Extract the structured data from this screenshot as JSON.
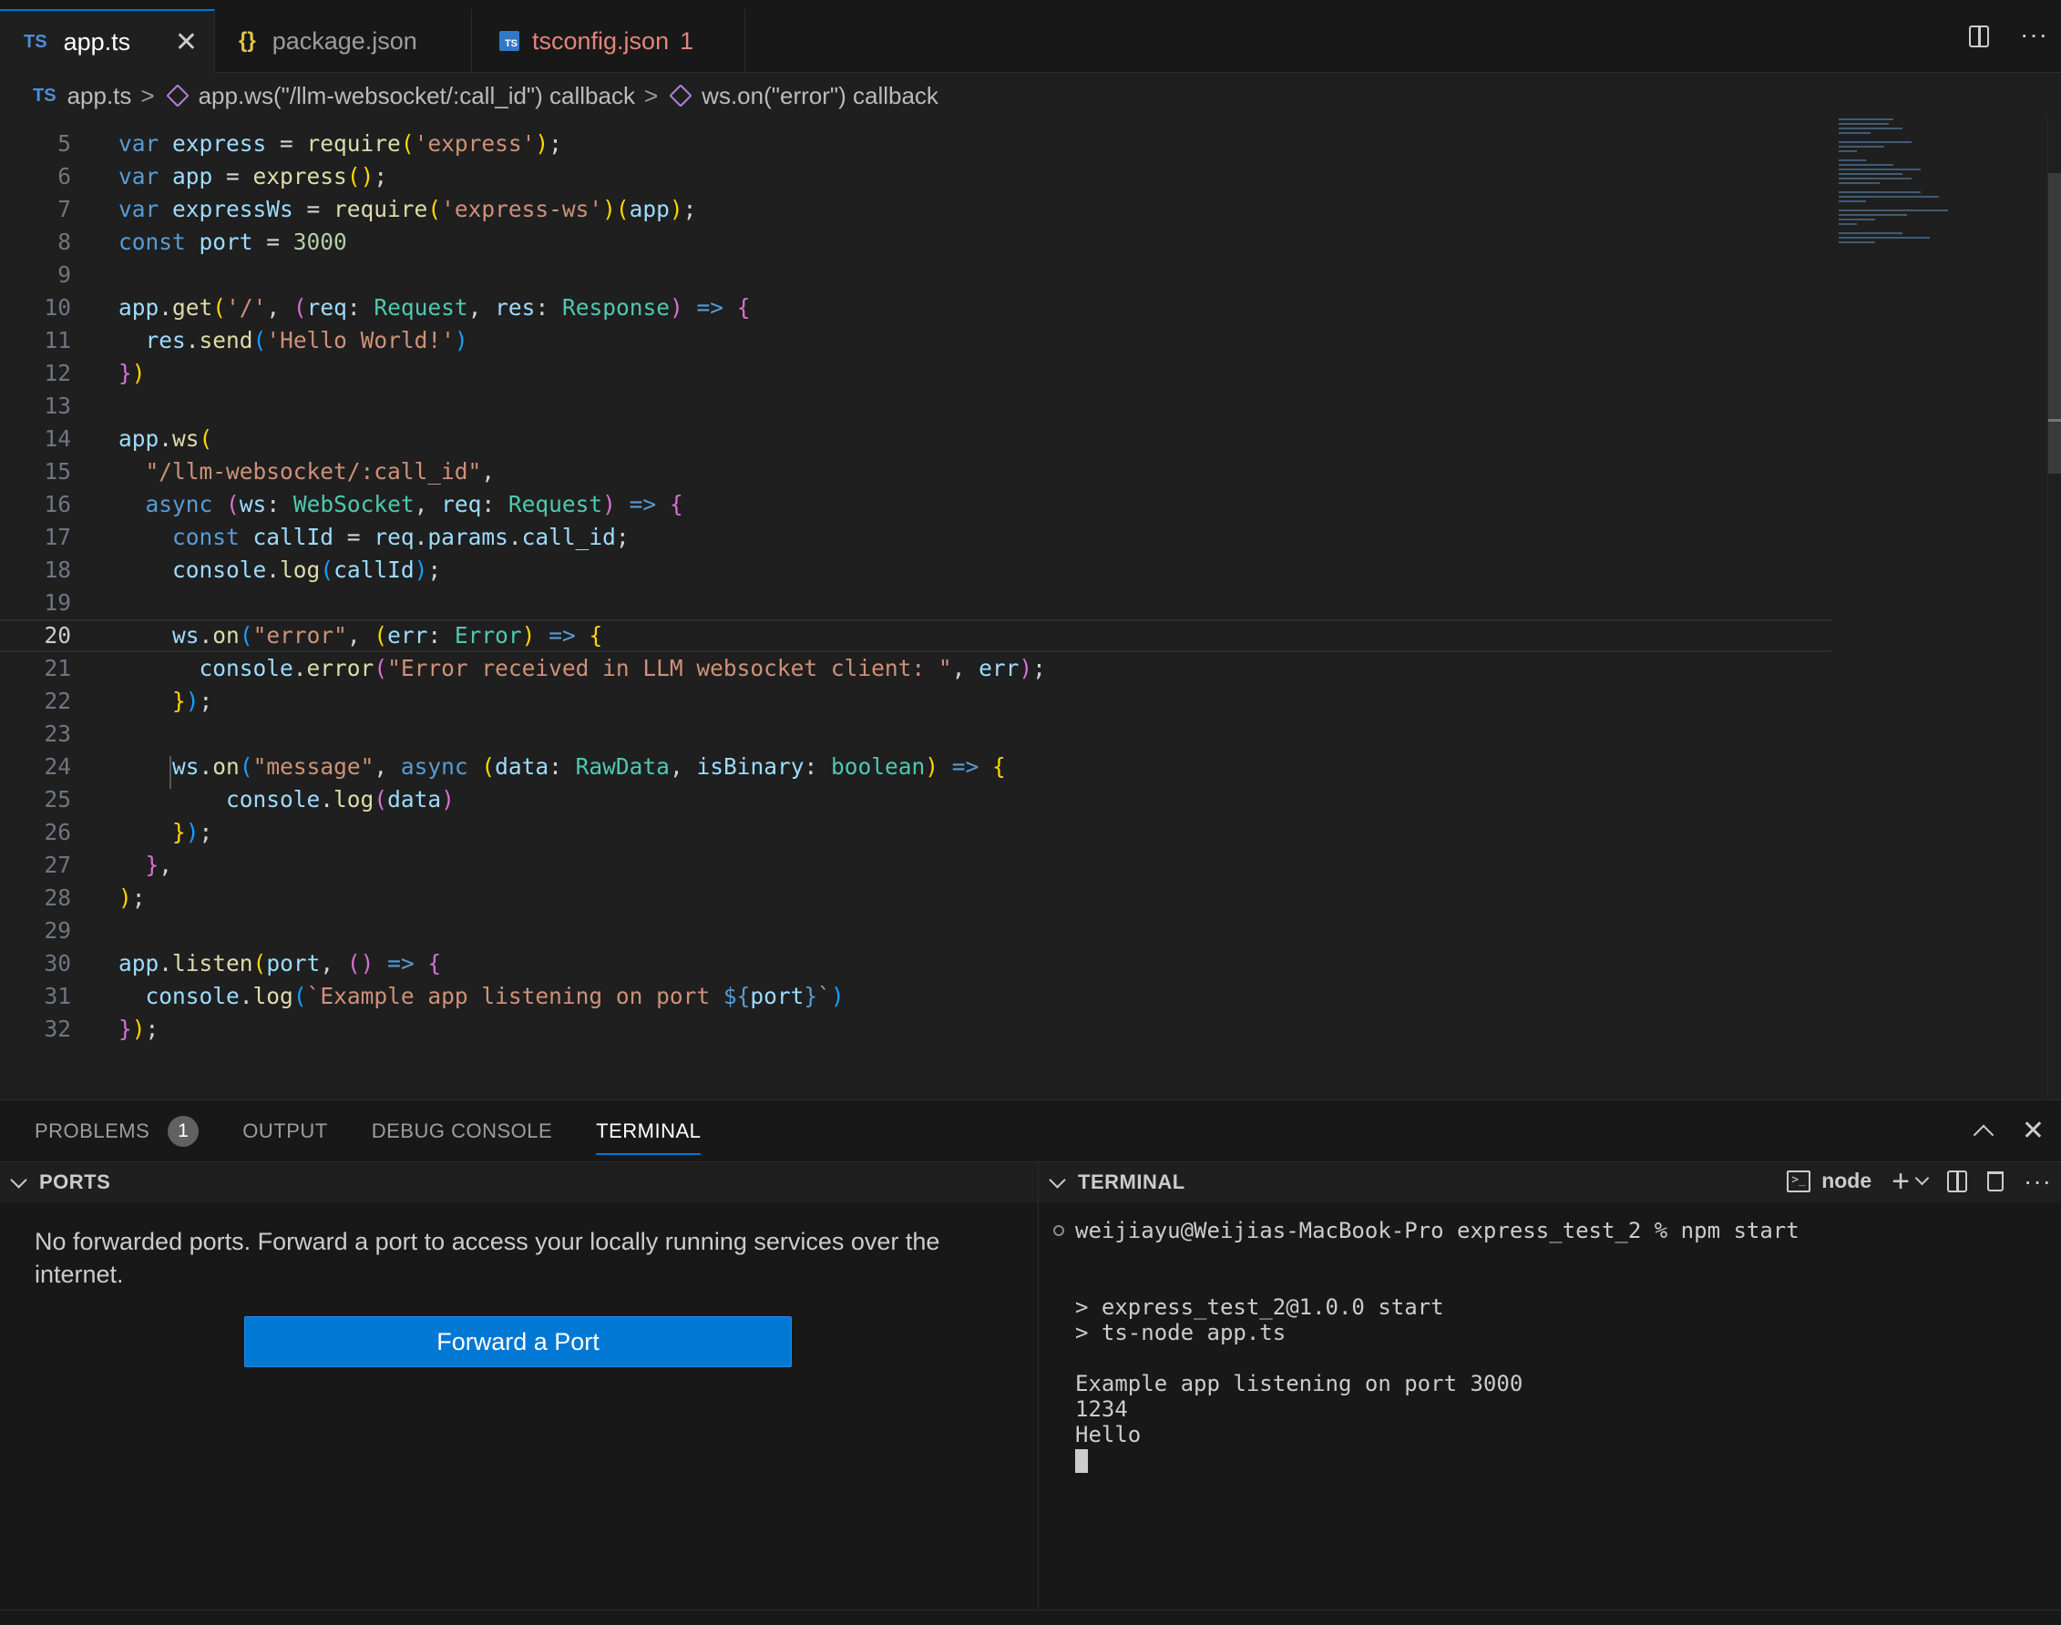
{
  "tabs": [
    {
      "icon": "TS",
      "label": "app.ts",
      "close": "✕"
    },
    {
      "icon": "{}",
      "label": "package.json"
    },
    {
      "icon": "TS",
      "label": "tsconfig.json",
      "problems": "1"
    }
  ],
  "breadcrumbs": {
    "file_icon": "TS",
    "file": "app.ts",
    "separator": ">",
    "symbol1": "app.ws(\"/llm-websocket/:call_id\") callback",
    "symbol2": "ws.on(\"error\") callback"
  },
  "editor": {
    "current_line": 20,
    "lines": [
      {
        "n": 5,
        "tokens": [
          [
            "kw",
            "var "
          ],
          [
            "var",
            "express"
          ],
          [
            "pl",
            " = "
          ],
          [
            "fn",
            "require"
          ],
          [
            "b1",
            "("
          ],
          [
            "str",
            "'express'"
          ],
          [
            "b1",
            ")"
          ],
          [
            "pl",
            ";"
          ]
        ]
      },
      {
        "n": 6,
        "tokens": [
          [
            "kw",
            "var "
          ],
          [
            "var",
            "app"
          ],
          [
            "pl",
            " = "
          ],
          [
            "fn",
            "express"
          ],
          [
            "b1",
            "()"
          ],
          [
            "pl",
            ";"
          ]
        ]
      },
      {
        "n": 7,
        "tokens": [
          [
            "kw",
            "var "
          ],
          [
            "var",
            "expressWs"
          ],
          [
            "pl",
            " = "
          ],
          [
            "fn",
            "require"
          ],
          [
            "b1",
            "("
          ],
          [
            "str",
            "'express-ws'"
          ],
          [
            "b1",
            ")("
          ],
          [
            "var",
            "app"
          ],
          [
            "b1",
            ")"
          ],
          [
            "pl",
            ";"
          ]
        ]
      },
      {
        "n": 8,
        "tokens": [
          [
            "kw",
            "const "
          ],
          [
            "var",
            "port"
          ],
          [
            "pl",
            " = "
          ],
          [
            "num",
            "3000"
          ]
        ]
      },
      {
        "n": 9,
        "tokens": []
      },
      {
        "n": 10,
        "tokens": [
          [
            "var",
            "app"
          ],
          [
            "pl",
            "."
          ],
          [
            "fn",
            "get"
          ],
          [
            "b1",
            "("
          ],
          [
            "str",
            "'/'"
          ],
          [
            "pl",
            ", "
          ],
          [
            "b2",
            "("
          ],
          [
            "var",
            "req"
          ],
          [
            "pl",
            ": "
          ],
          [
            "type",
            "Request"
          ],
          [
            "pl",
            ", "
          ],
          [
            "var",
            "res"
          ],
          [
            "pl",
            ": "
          ],
          [
            "type",
            "Response"
          ],
          [
            "b2",
            ")"
          ],
          [
            "kw",
            " => "
          ],
          [
            "b2",
            "{"
          ]
        ]
      },
      {
        "n": 11,
        "tokens": [
          [
            "pl",
            "  "
          ],
          [
            "var",
            "res"
          ],
          [
            "pl",
            "."
          ],
          [
            "fn",
            "send"
          ],
          [
            "b3",
            "("
          ],
          [
            "str",
            "'Hello World!'"
          ],
          [
            "b3",
            ")"
          ]
        ]
      },
      {
        "n": 12,
        "tokens": [
          [
            "b2",
            "}"
          ],
          [
            "b1",
            ")"
          ]
        ]
      },
      {
        "n": 13,
        "tokens": []
      },
      {
        "n": 14,
        "tokens": [
          [
            "var",
            "app"
          ],
          [
            "pl",
            "."
          ],
          [
            "fn",
            "ws"
          ],
          [
            "b1",
            "("
          ]
        ]
      },
      {
        "n": 15,
        "tokens": [
          [
            "pl",
            "  "
          ],
          [
            "str",
            "\"/llm-websocket/:call_id\""
          ],
          [
            "pl",
            ","
          ]
        ]
      },
      {
        "n": 16,
        "tokens": [
          [
            "pl",
            "  "
          ],
          [
            "kw",
            "async "
          ],
          [
            "b2",
            "("
          ],
          [
            "var",
            "ws"
          ],
          [
            "pl",
            ": "
          ],
          [
            "type",
            "WebSocket"
          ],
          [
            "pl",
            ", "
          ],
          [
            "var",
            "req"
          ],
          [
            "pl",
            ": "
          ],
          [
            "type",
            "Request"
          ],
          [
            "b2",
            ")"
          ],
          [
            "kw",
            " => "
          ],
          [
            "b2",
            "{"
          ]
        ]
      },
      {
        "n": 17,
        "tokens": [
          [
            "pl",
            "    "
          ],
          [
            "kw",
            "const "
          ],
          [
            "var",
            "callId"
          ],
          [
            "pl",
            " = "
          ],
          [
            "var",
            "req"
          ],
          [
            "pl",
            "."
          ],
          [
            "var",
            "params"
          ],
          [
            "pl",
            "."
          ],
          [
            "var",
            "call_id"
          ],
          [
            "pl",
            ";"
          ]
        ]
      },
      {
        "n": 18,
        "tokens": [
          [
            "pl",
            "    "
          ],
          [
            "var",
            "console"
          ],
          [
            "pl",
            "."
          ],
          [
            "fn",
            "log"
          ],
          [
            "b3",
            "("
          ],
          [
            "var",
            "callId"
          ],
          [
            "b3",
            ")"
          ],
          [
            "pl",
            ";"
          ]
        ]
      },
      {
        "n": 19,
        "tokens": []
      },
      {
        "n": 20,
        "tokens": [
          [
            "pl",
            "    "
          ],
          [
            "var",
            "ws"
          ],
          [
            "pl",
            "."
          ],
          [
            "fn",
            "on"
          ],
          [
            "b3",
            "("
          ],
          [
            "str",
            "\"error\""
          ],
          [
            "pl",
            ", "
          ],
          [
            "b1",
            "("
          ],
          [
            "var",
            "err"
          ],
          [
            "pl",
            ": "
          ],
          [
            "type",
            "Error"
          ],
          [
            "b1",
            ")"
          ],
          [
            "kw",
            " => "
          ],
          [
            "b1",
            "{"
          ]
        ]
      },
      {
        "n": 21,
        "tokens": [
          [
            "pl",
            "      "
          ],
          [
            "var",
            "console"
          ],
          [
            "pl",
            "."
          ],
          [
            "fn",
            "error"
          ],
          [
            "b2",
            "("
          ],
          [
            "str",
            "\"Error received in LLM websocket client: \""
          ],
          [
            "pl",
            ", "
          ],
          [
            "var",
            "err"
          ],
          [
            "b2",
            ")"
          ],
          [
            "pl",
            ";"
          ]
        ]
      },
      {
        "n": 22,
        "tokens": [
          [
            "pl",
            "    "
          ],
          [
            "b1",
            "}"
          ],
          [
            "b3",
            ")"
          ],
          [
            "pl",
            ";"
          ]
        ]
      },
      {
        "n": 23,
        "tokens": []
      },
      {
        "n": 24,
        "tokens": [
          [
            "pl",
            "    "
          ],
          [
            "var",
            "ws"
          ],
          [
            "pl",
            "."
          ],
          [
            "fn",
            "on"
          ],
          [
            "b3",
            "("
          ],
          [
            "str",
            "\"message\""
          ],
          [
            "pl",
            ", "
          ],
          [
            "kw",
            "async "
          ],
          [
            "b1",
            "("
          ],
          [
            "var",
            "data"
          ],
          [
            "pl",
            ": "
          ],
          [
            "type",
            "RawData"
          ],
          [
            "pl",
            ", "
          ],
          [
            "var",
            "isBinary"
          ],
          [
            "pl",
            ": "
          ],
          [
            "type",
            "boolean"
          ],
          [
            "b1",
            ")"
          ],
          [
            "kw",
            " => "
          ],
          [
            "b1",
            "{"
          ]
        ]
      },
      {
        "n": 25,
        "tokens": [
          [
            "pl",
            "        "
          ],
          [
            "var",
            "console"
          ],
          [
            "pl",
            "."
          ],
          [
            "fn",
            "log"
          ],
          [
            "b2",
            "("
          ],
          [
            "var",
            "data"
          ],
          [
            "b2",
            ")"
          ]
        ]
      },
      {
        "n": 26,
        "tokens": [
          [
            "pl",
            "    "
          ],
          [
            "b1",
            "}"
          ],
          [
            "b3",
            ")"
          ],
          [
            "pl",
            ";"
          ]
        ]
      },
      {
        "n": 27,
        "tokens": [
          [
            "pl",
            "  "
          ],
          [
            "b2",
            "}"
          ],
          [
            "pl",
            ","
          ]
        ]
      },
      {
        "n": 28,
        "tokens": [
          [
            "b1",
            ")"
          ],
          [
            "pl",
            ";"
          ]
        ]
      },
      {
        "n": 29,
        "tokens": []
      },
      {
        "n": 30,
        "tokens": [
          [
            "var",
            "app"
          ],
          [
            "pl",
            "."
          ],
          [
            "fn",
            "listen"
          ],
          [
            "b1",
            "("
          ],
          [
            "var",
            "port"
          ],
          [
            "pl",
            ", "
          ],
          [
            "b2",
            "()"
          ],
          [
            "kw",
            " => "
          ],
          [
            "b2",
            "{"
          ]
        ]
      },
      {
        "n": 31,
        "tokens": [
          [
            "pl",
            "  "
          ],
          [
            "var",
            "console"
          ],
          [
            "pl",
            "."
          ],
          [
            "fn",
            "log"
          ],
          [
            "b3",
            "("
          ],
          [
            "str",
            "`Example app listening on port "
          ],
          [
            "kw",
            "${"
          ],
          [
            "var",
            "port"
          ],
          [
            "kw",
            "}"
          ],
          [
            "str",
            "`"
          ],
          [
            "b3",
            ")"
          ]
        ]
      },
      {
        "n": 32,
        "tokens": [
          [
            "b2",
            "}"
          ],
          [
            "b1",
            ")"
          ],
          [
            "pl",
            ";"
          ]
        ]
      }
    ]
  },
  "panel": {
    "tabs": [
      {
        "label": "PROBLEMS",
        "badge": "1"
      },
      {
        "label": "OUTPUT"
      },
      {
        "label": "DEBUG CONSOLE"
      },
      {
        "label": "TERMINAL",
        "active": true
      }
    ]
  },
  "ports": {
    "header": "PORTS",
    "message": "No forwarded ports. Forward a port to access your locally running services over the internet.",
    "button": "Forward a Port"
  },
  "terminal": {
    "header": "TERMINAL",
    "shell": "node",
    "lines": [
      "weijiayu@Weijias-MacBook-Pro express_test_2 % npm start",
      "",
      "",
      "> express_test_2@1.0.0 start",
      "> ts-node app.ts",
      "",
      "Example app listening on port 3000",
      "1234",
      "Hello"
    ]
  },
  "colors": {
    "accent": "#0078d4",
    "background": "#1f1f1f",
    "panel_background": "#181818"
  }
}
